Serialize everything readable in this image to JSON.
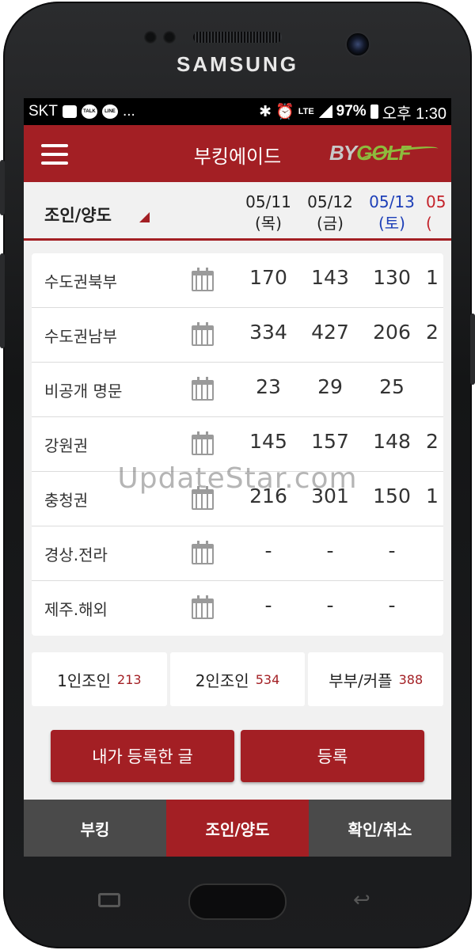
{
  "device": {
    "brand": "SAMSUNG"
  },
  "status_bar": {
    "carrier": "SKT",
    "talk": "TALK",
    "line": "LINE",
    "dots": "...",
    "network": "LTE",
    "battery": "97%",
    "time": "오후 1:30"
  },
  "app_bar": {
    "title": "부킹에이드",
    "logo_by": "BY",
    "logo_golf": "GOLF"
  },
  "header": {
    "selector": "조인/양도",
    "dates": [
      {
        "date": "05/11",
        "day": "(목)"
      },
      {
        "date": "05/12",
        "day": "(금)"
      },
      {
        "date": "05/13",
        "day": "(토)"
      },
      {
        "date": "05",
        "day": "("
      }
    ]
  },
  "regions": [
    {
      "name": "수도권북부",
      "counts": [
        "170",
        "143",
        "130",
        "1"
      ]
    },
    {
      "name": "수도권남부",
      "counts": [
        "334",
        "427",
        "206",
        "2"
      ]
    },
    {
      "name": "비공개 명문",
      "counts": [
        "23",
        "29",
        "25",
        ""
      ]
    },
    {
      "name": "강원권",
      "counts": [
        "145",
        "157",
        "148",
        "2"
      ]
    },
    {
      "name": "충청권",
      "counts": [
        "216",
        "301",
        "150",
        "1"
      ]
    },
    {
      "name": "경상.전라",
      "counts": [
        "-",
        "-",
        "-",
        ""
      ]
    },
    {
      "name": "제주.해외",
      "counts": [
        "-",
        "-",
        "-",
        ""
      ]
    }
  ],
  "types": [
    {
      "label": "1인조인",
      "count": "213"
    },
    {
      "label": "2인조인",
      "count": "534"
    },
    {
      "label": "부부/커플",
      "count": "388"
    }
  ],
  "buttons": {
    "my_posts": "내가 등록한 글",
    "register": "등록"
  },
  "tabs": [
    {
      "label": "부킹",
      "active": false
    },
    {
      "label": "조인/양도",
      "active": true
    },
    {
      "label": "확인/취소",
      "active": false
    }
  ],
  "watermark": "UpdateStar.com",
  "colors": {
    "brand": "#a31f24",
    "saturday": "#1d3fb8",
    "sunday": "#c4232b",
    "tab_inactive": "#4a4a4a"
  }
}
